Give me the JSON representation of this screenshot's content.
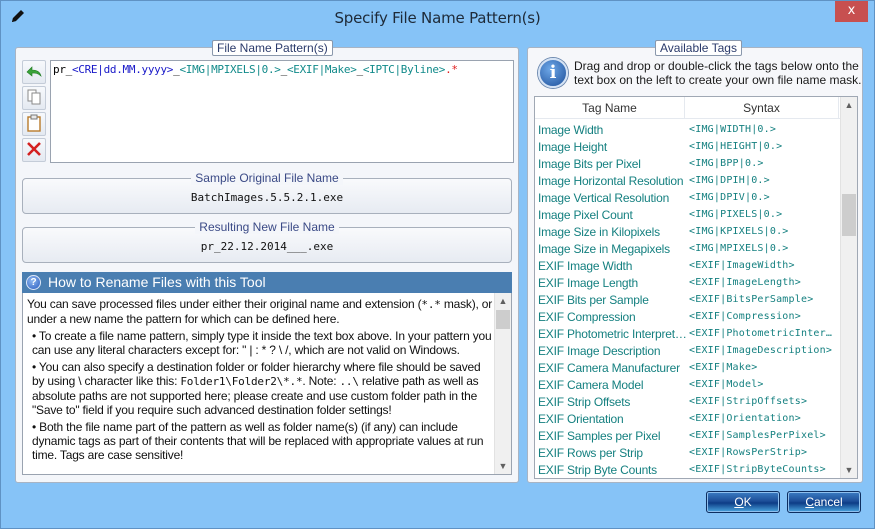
{
  "window": {
    "title": "Specify File Name Pattern(s)",
    "close_label": "x",
    "title_icon": "pencil-icon"
  },
  "pattern_group": {
    "legend": "File Name Pattern(s)",
    "tools": [
      {
        "name": "undo",
        "icon": "undo-arrow-icon"
      },
      {
        "name": "copy",
        "icon": "copy-icon"
      },
      {
        "name": "paste",
        "icon": "clipboard-icon"
      },
      {
        "name": "clear",
        "icon": "red-x-icon"
      }
    ],
    "value": "pr_<CRE|dd.MM.yyyy>_<IMG|MPIXELS|0.>_<EXIF|Make>_<IPTC|Byline>.*",
    "tokens": [
      {
        "text": "pr_",
        "kind": "literal"
      },
      {
        "text": "<CRE|dd.MM.yyyy>",
        "kind": "cre"
      },
      {
        "text": "_",
        "kind": "literal"
      },
      {
        "text": "<IMG|MPIXELS|0.>",
        "kind": "tag"
      },
      {
        "text": "_",
        "kind": "literal"
      },
      {
        "text": "<EXIF|Make>",
        "kind": "tag"
      },
      {
        "text": "_",
        "kind": "literal"
      },
      {
        "text": "<IPTC|Byline>",
        "kind": "tag"
      },
      {
        "text": ".*",
        "kind": "ext"
      }
    ]
  },
  "sample": {
    "label": "Sample Original File Name",
    "value": "BatchImages.5.5.2.1.exe"
  },
  "result": {
    "label": "Resulting New File Name",
    "value": "pr_22.12.2014___.exe"
  },
  "help": {
    "title": "How to Rename Files with this Tool",
    "p1_a": "You can save processed files under either their original name and extension (",
    "p1_mono": "*.*",
    "p1_b": " mask), or under a new name the pattern for which can be defined here.",
    "p2": "• To create a file name pattern, simply type it inside the text box above. In your pattern you can use any literal characters except for: \" | : * ? \\ /, which are not valid on Windows.",
    "p3_a": "• You can also specify a destination folder or folder hierarchy where file should be saved by using \\ character like this: ",
    "p3_mono1": "Folder1\\Folder2\\*.*",
    "p3_b": ". Note: ",
    "p3_mono2": "..\\",
    "p3_c": " relative path as well as absolute paths are not supported here; please create and use custom folder path in the \"Save to\" field if you require such advanced destination folder settings!",
    "p4": "• Both the file name part of the pattern as well as folder name(s) (if any) can include dynamic tags as part of their contents that will be replaced with appropriate values at run time. Tags are case sensitive!"
  },
  "tags": {
    "legend": "Available Tags",
    "info": "Drag and drop or double-click the tags below onto the text box on the left to create your own file name mask.",
    "columns": [
      "Tag Name",
      "Syntax"
    ],
    "rows": [
      {
        "name": "Image Width",
        "syntax": "<IMG|WIDTH|0.>"
      },
      {
        "name": "Image Height",
        "syntax": "<IMG|HEIGHT|0.>"
      },
      {
        "name": "Image Bits per Pixel",
        "syntax": "<IMG|BPP|0.>"
      },
      {
        "name": "Image Horizontal Resolution",
        "syntax": "<IMG|DPIH|0.>"
      },
      {
        "name": "Image Vertical Resolution",
        "syntax": "<IMG|DPIV|0.>"
      },
      {
        "name": "Image Pixel Count",
        "syntax": "<IMG|PIXELS|0.>"
      },
      {
        "name": "Image Size in Kilopixels",
        "syntax": "<IMG|KPIXELS|0.>"
      },
      {
        "name": "Image Size in Megapixels",
        "syntax": "<IMG|MPIXELS|0.>"
      },
      {
        "name": "EXIF Image Width",
        "syntax": "<EXIF|ImageWidth>"
      },
      {
        "name": "EXIF Image Length",
        "syntax": "<EXIF|ImageLength>"
      },
      {
        "name": "EXIF Bits per Sample",
        "syntax": "<EXIF|BitsPerSample>"
      },
      {
        "name": "EXIF Compression",
        "syntax": "<EXIF|Compression>"
      },
      {
        "name": "EXIF  Photometric  Interpret…",
        "syntax": "<EXIF|PhotometricInter…"
      },
      {
        "name": "EXIF Image Description",
        "syntax": "<EXIF|ImageDescription>"
      },
      {
        "name": "EXIF Camera Manufacturer",
        "syntax": "<EXIF|Make>"
      },
      {
        "name": "EXIF Camera Model",
        "syntax": "<EXIF|Model>"
      },
      {
        "name": "EXIF Strip Offsets",
        "syntax": "<EXIF|StripOffsets>"
      },
      {
        "name": "EXIF Orientation",
        "syntax": "<EXIF|Orientation>"
      },
      {
        "name": "EXIF Samples per Pixel",
        "syntax": "<EXIF|SamplesPerPixel>"
      },
      {
        "name": "EXIF Rows per Strip",
        "syntax": "<EXIF|RowsPerStrip>"
      },
      {
        "name": "EXIF Strip Byte Counts",
        "syntax": "<EXIF|StripByteCounts>"
      }
    ]
  },
  "buttons": {
    "ok_accel": "O",
    "ok_rest": "K",
    "cancel_accel": "C",
    "cancel_rest": "ancel"
  },
  "colors": {
    "window_bg": "#86c3f7",
    "close_bg": "#c75050",
    "help_header": "#4a7eb1",
    "tag_text": "#158080",
    "cre_token": "#1818c8",
    "ext_token": "#e02020"
  }
}
